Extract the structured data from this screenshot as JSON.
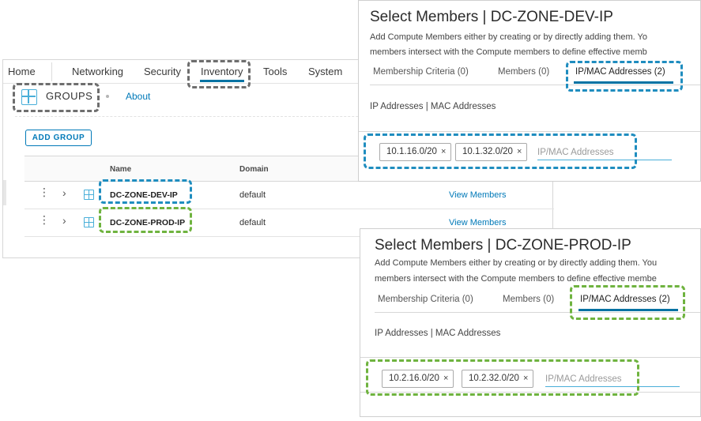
{
  "nav": {
    "items": [
      "Home",
      "Networking",
      "Security",
      "Inventory",
      "Tools",
      "System"
    ],
    "active": "Inventory"
  },
  "groups_header": {
    "title": "GROUPS",
    "about": "About"
  },
  "toolbar": {
    "add_group": "ADD GROUP"
  },
  "table": {
    "columns": {
      "name": "Name",
      "domain": "Domain"
    },
    "rows": [
      {
        "name": "DC-ZONE-DEV-IP",
        "domain": "default",
        "action": "View Members",
        "highlight": "blue"
      },
      {
        "name": "DC-ZONE-PROD-IP",
        "domain": "default",
        "action": "View Members",
        "highlight": "green"
      }
    ]
  },
  "dialogs": [
    {
      "title": "Select Members | DC-ZONE-DEV-IP",
      "desc_line1": "Add Compute Members either by creating or by directly adding them. Yo",
      "desc_line2": "members intersect with the Compute members to define effective memb",
      "tabs": [
        "Membership Criteria (0)",
        "Members (0)",
        "IP/MAC Addresses (2)"
      ],
      "active_tab": "IP/MAC Addresses (2)",
      "subtitle": "IP Addresses | MAC Addresses",
      "chips": [
        "10.1.16.0/20",
        "10.1.32.0/20"
      ],
      "input_placeholder": "IP/MAC Addresses"
    },
    {
      "title": "Select Members | DC-ZONE-PROD-IP",
      "desc_line1": "Add Compute Members either by creating or by directly adding them. You",
      "desc_line2": "members intersect with the Compute members to define effective membe",
      "tabs": [
        "Membership Criteria (0)",
        "Members (0)",
        "IP/MAC Addresses (2)"
      ],
      "active_tab": "IP/MAC Addresses (2)",
      "subtitle": "IP Addresses | MAC Addresses",
      "chips": [
        "10.2.16.0/20",
        "10.2.32.0/20"
      ],
      "input_placeholder": "IP/MAC Addresses"
    }
  ],
  "chip_remove_glyph": "×",
  "colors": {
    "accent": "#0079b8",
    "highlight_gray": "#6e6e6e",
    "highlight_blue": "#1f8dbf",
    "highlight_green": "#6fb33f"
  },
  "icons": [
    "groups-grid-icon",
    "kebab-menu-icon",
    "chevron-right-icon",
    "close-icon"
  ]
}
